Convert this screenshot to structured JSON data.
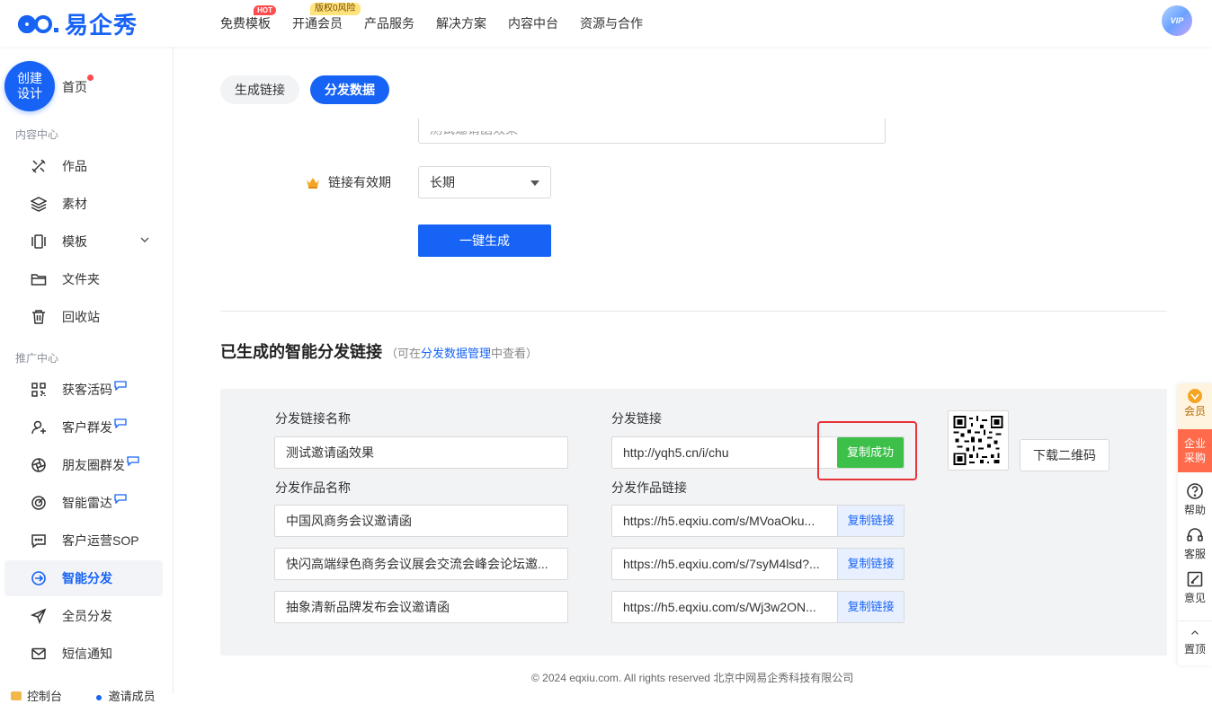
{
  "brand": {
    "name": "易企秀"
  },
  "nav": {
    "items": [
      {
        "label": "免费模板",
        "badge": "HOT"
      },
      {
        "label": "开通会员",
        "badge": "版权0风险"
      },
      {
        "label": "产品服务"
      },
      {
        "label": "解决方案"
      },
      {
        "label": "内容中台"
      },
      {
        "label": "资源与合作"
      }
    ],
    "avatar_label": "VIP"
  },
  "sidebar": {
    "create_label_1": "创建",
    "create_label_2": "设计",
    "home": "首页",
    "section_content": "内容中心",
    "content_items": [
      {
        "label": "作品",
        "icon": "brush-icon"
      },
      {
        "label": "素材",
        "icon": "layers-icon"
      },
      {
        "label": "模板",
        "icon": "template-icon"
      },
      {
        "label": "文件夹",
        "icon": "folder-icon"
      },
      {
        "label": "回收站",
        "icon": "trash-icon"
      }
    ],
    "section_promo": "推广中心",
    "promo_items": [
      {
        "label": "获客活码",
        "icon": "qrcode-icon"
      },
      {
        "label": "客户群发",
        "icon": "user-icon"
      },
      {
        "label": "朋友圈群发",
        "icon": "aperture-icon"
      },
      {
        "label": "智能雷达",
        "icon": "radar-icon"
      },
      {
        "label": "客户运营SOP",
        "icon": "chat-icon"
      },
      {
        "label": "智能分发",
        "icon": "share-icon"
      },
      {
        "label": "全员分发",
        "icon": "send-icon"
      },
      {
        "label": "短信通知",
        "icon": "mail-icon"
      }
    ],
    "bottom_left": "控制台",
    "bottom_right": "邀请成员"
  },
  "tabs": [
    {
      "label": "生成链接",
      "active": false
    },
    {
      "label": "分发数据",
      "active": true
    }
  ],
  "form": {
    "cut_value": "测试邀请函效果",
    "validity_label": "链接有效期",
    "validity_value": "长期",
    "generate_button": "一键生成"
  },
  "results": {
    "title": "已生成的智能分发链接",
    "hint_prefix": "（可在",
    "hint_link": "分发数据管理",
    "hint_suffix": "中查看）",
    "name_label": "分发链接名称",
    "name_value": "测试邀请函效果",
    "link_label": "分发链接",
    "link_value": "http://yqh5.cn/i/chu",
    "copy_success": "复制成功",
    "download_qr": "下载二维码",
    "works_name_label": "分发作品名称",
    "works_link_label": "分发作品链接",
    "copy_link": "复制链接",
    "works": [
      {
        "name": "中国风商务会议邀请函",
        "link": "https://h5.eqxiu.com/s/MVoaOku..."
      },
      {
        "name": "快闪高端绿色商务会议展会交流会峰会论坛邀...",
        "link": "https://h5.eqxiu.com/s/7syM4lsd?..."
      },
      {
        "name": "抽象清新品牌发布会议邀请函",
        "link": "https://h5.eqxiu.com/s/Wj3w2ON..."
      }
    ]
  },
  "footer": "© 2024 eqxiu.com. All rights reserved 北京中网易企秀科技有限公司",
  "float_bar": {
    "vip": "会员",
    "buy_1": "企业",
    "buy_2": "采购",
    "help": "帮助",
    "service": "客服",
    "feedback": "意见",
    "top": "置顶"
  },
  "colors": {
    "primary": "#1763f6",
    "success": "#3dc04a",
    "highlight_box": "#e8323a"
  }
}
